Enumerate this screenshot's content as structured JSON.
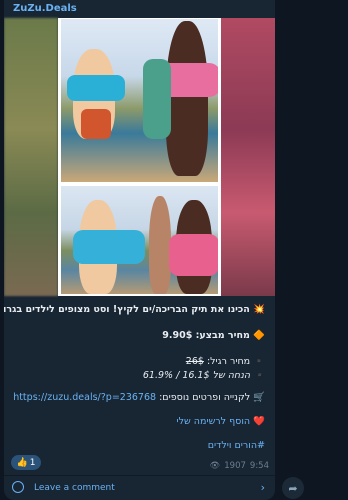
{
  "channel": {
    "name": "ZuZu.Deals"
  },
  "post": {
    "headline": "הכינו את תיק הבריכה/ים לקיץ! וסט מצופים לילדים בגרושים!",
    "headline_icon": "💥",
    "sale_price_label": "מחיר מבצע: 9.90$",
    "sale_price_icon": "🔶",
    "regular_price_prefix": "מחיר רגיל:",
    "regular_price_value": "26$",
    "regular_bullet": "▪️",
    "savings_text": "הנחה של 16.1$ / 61.9%",
    "savings_bullet": "▪️",
    "buy_prefix": "לקנייה ופרטים נוספים:",
    "buy_link": "https://zuzu.deals/?p=236768",
    "buy_icon": "🛒",
    "wishlist_text": "הוסף לרשימה שלי",
    "wishlist_icon": "❤️",
    "hashtag": "#הורים וילדים"
  },
  "reaction": {
    "emoji": "👍",
    "count": "1"
  },
  "meta": {
    "views": "1907",
    "time": "9:54"
  },
  "comments": {
    "label": "Leave a comment"
  }
}
